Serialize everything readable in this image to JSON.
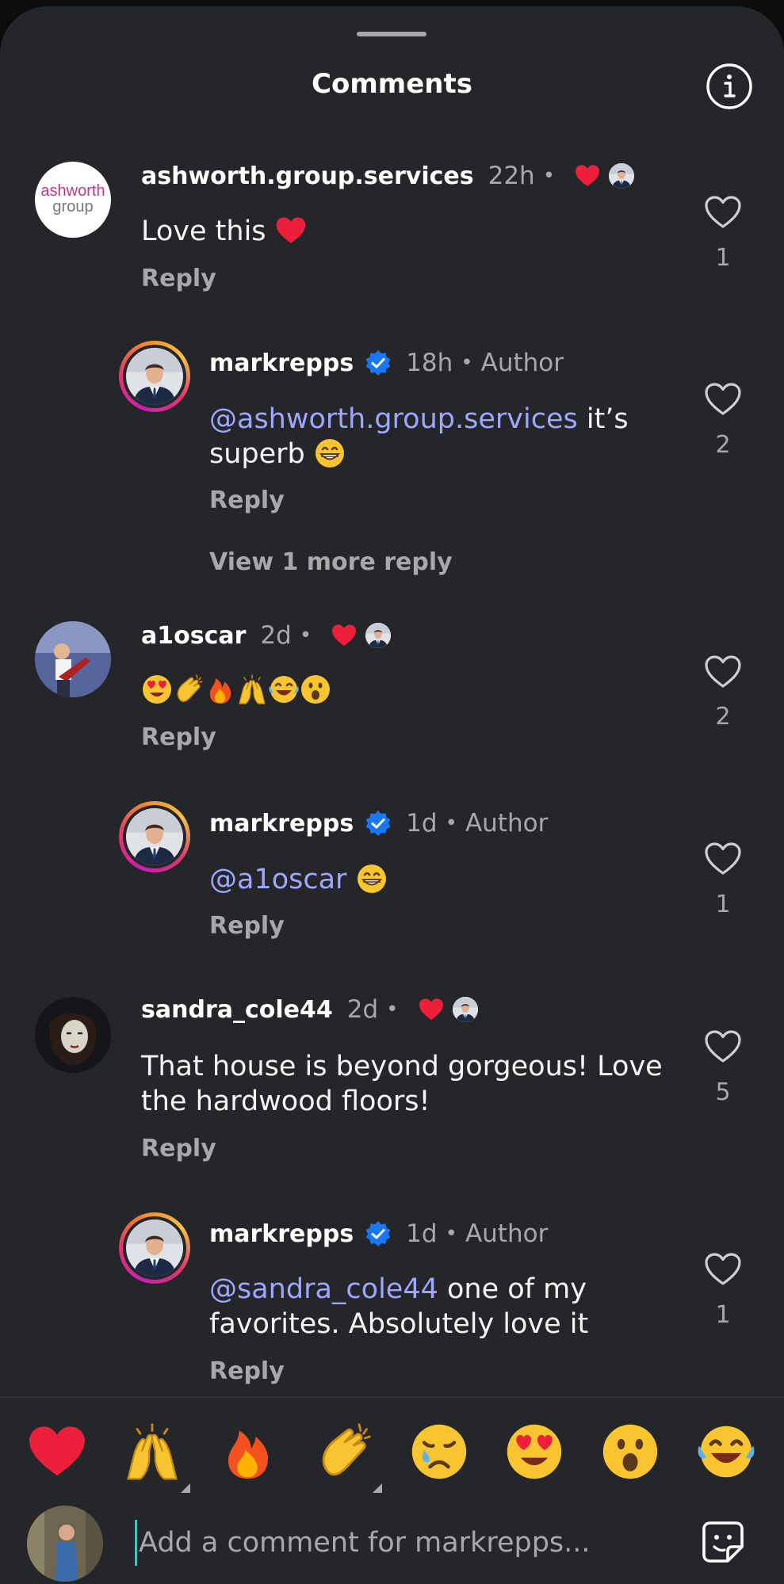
{
  "header": {
    "title": "Comments"
  },
  "comments": [
    {
      "username": "ashworth.group.services",
      "time": "22h",
      "text": "Love this",
      "reply": "Reply",
      "likes": "1",
      "avatar_line1": "ashworth",
      "avatar_line2": "group"
    },
    {
      "username": "markrepps",
      "time": "18h",
      "author": "Author",
      "mention": "@ashworth.group.services",
      "text_line1": " it’s",
      "text_line2": "superb",
      "reply": "Reply",
      "likes": "2",
      "view_more": "View 1 more reply"
    },
    {
      "username": "a1oscar",
      "time": "2d",
      "reply": "Reply",
      "likes": "2"
    },
    {
      "username": "markrepps",
      "time": "1d",
      "author": "Author",
      "mention": "@a1oscar",
      "reply": "Reply",
      "likes": "1"
    },
    {
      "username": "sandra_cole44",
      "time": "2d",
      "text_line1": "That house is beyond gorgeous! Love",
      "text_line2": "the hardwood floors!",
      "reply": "Reply",
      "likes": "5"
    },
    {
      "username": "markrepps",
      "time": "1d",
      "author": "Author",
      "mention": "@sandra_cole44",
      "text_line1": " one of my",
      "text_line2": "favorites. Absolutely love it",
      "reply": "Reply",
      "likes": "1"
    }
  ],
  "separator": "•",
  "composer": {
    "placeholder": "Add a comment for markrepps..."
  },
  "reactions": [
    "heart",
    "raising-hands",
    "fire",
    "clapping-hands",
    "crying-face",
    "heart-eyes",
    "surprised-face",
    "tears-of-joy"
  ],
  "colors": {
    "background": "#25262a",
    "mention": "#9fa6ff",
    "secondary_text": "#a8a8ab",
    "like_red": "#ed1f3a",
    "verified": "#1877f2"
  }
}
